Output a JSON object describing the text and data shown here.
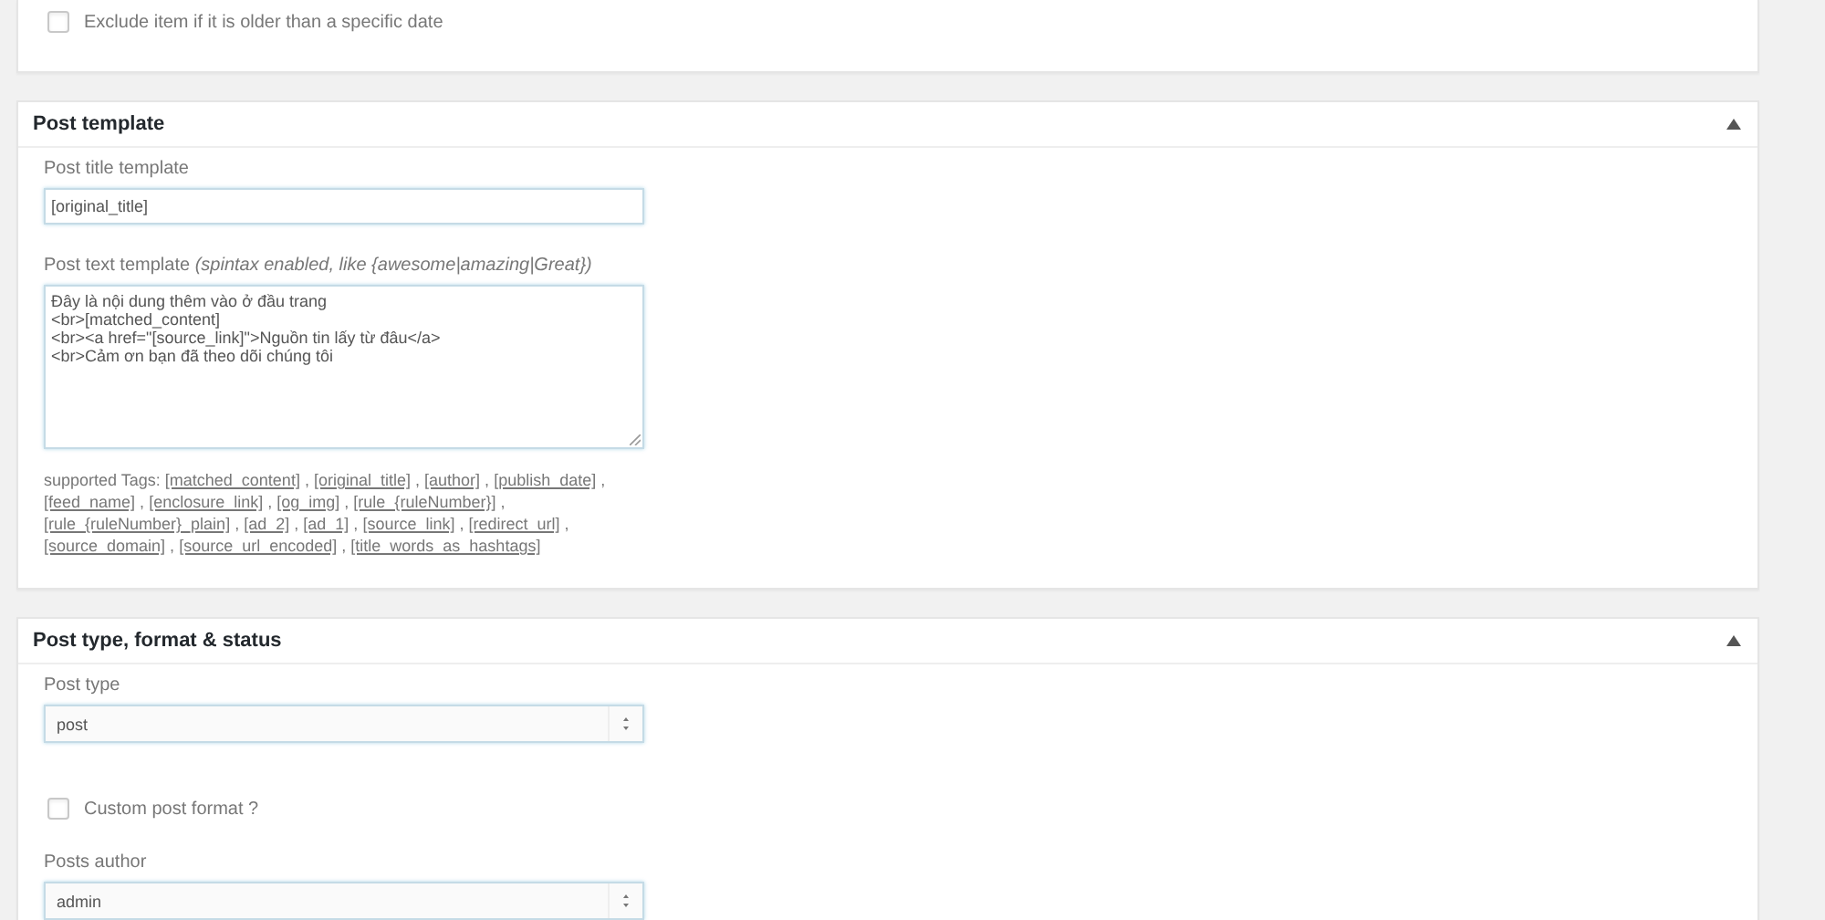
{
  "exclude_option": {
    "label": "Exclude item if it is older than a specific date",
    "checked": false
  },
  "post_template": {
    "title": "Post template",
    "expanded": true,
    "title_field": {
      "label": "Post title template",
      "value": "[original_title]"
    },
    "text_field": {
      "label": "Post text template",
      "note": "(spintax enabled, like {awesome|amazing|Great})",
      "lines": [
        "Đây là nội dung thêm vào ở đầu trang",
        "<br>[matched_content]",
        "<br><a href=\"[source_link]\">Nguồn tin lấy từ đâu</a>",
        "<br>Cảm ơn bạn đã theo dõi chúng tôi"
      ]
    },
    "tags_prefix": "supported Tags:",
    "tag_separator": ",",
    "tags": [
      "[matched_content]",
      "[original_title]",
      "[author]",
      "[publish_date]",
      "[feed_name]",
      "[enclosure_link]",
      "[og_img]",
      "[rule_{ruleNumber}]",
      "[rule_{ruleNumber}_plain]",
      "[ad_2]",
      "[ad_1]",
      "[source_link]",
      "[redirect_url]",
      "[source_domain]",
      "[source_url_encoded]",
      "[title_words_as_hashtags]"
    ]
  },
  "post_type_section": {
    "title": "Post type, format & status",
    "expanded": true,
    "post_type": {
      "label": "Post type",
      "value": "post"
    },
    "custom_format": {
      "label": "Custom post format ?",
      "checked": false
    },
    "author": {
      "label": "Posts author",
      "value": "admin"
    }
  }
}
